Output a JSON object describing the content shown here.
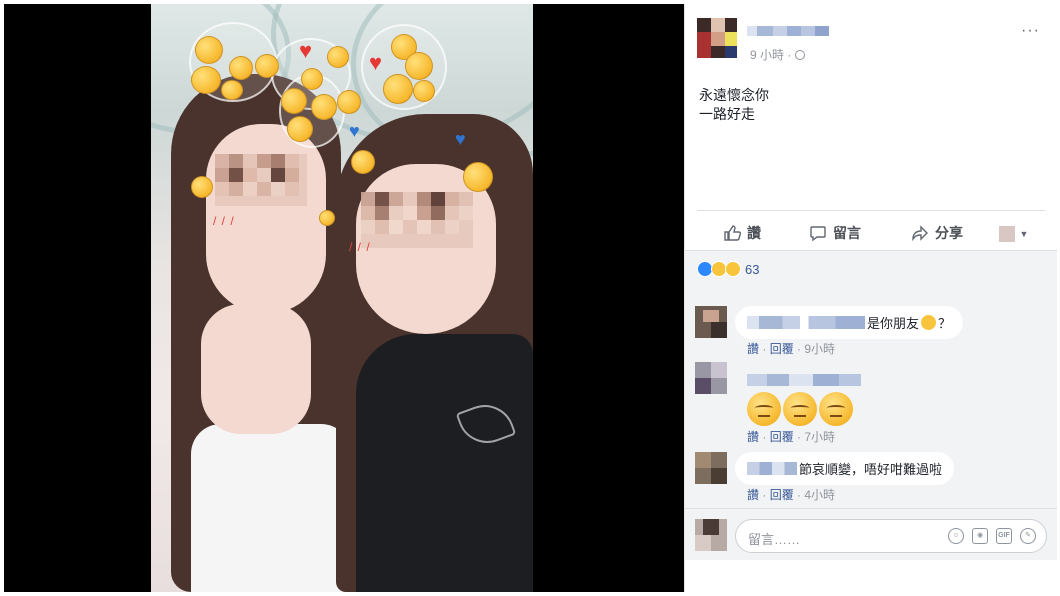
{
  "post": {
    "author_name": "",
    "timestamp": "9 小時",
    "privacy_icon": "globe-icon",
    "more_icon": "more-options-icon",
    "text_lines": [
      "永遠懷念你",
      "一路好走"
    ]
  },
  "actions": {
    "like": "讚",
    "comment": "留言",
    "share": "分享"
  },
  "reactions": {
    "icons": [
      "like-reaction-icon",
      "sad-reaction-icon",
      "wow-reaction-icon"
    ],
    "count": "63"
  },
  "comments": [
    {
      "author": "",
      "text": "是你朋友",
      "emoji": "sad-face-emoji",
      "suffix": "？",
      "like": "讚",
      "reply": "回覆",
      "time": "9小時"
    },
    {
      "author": "",
      "text": "",
      "emoji_count": 3,
      "emoji": "pensive-face-emoji",
      "like": "讚",
      "reply": "回覆",
      "time": "7小時"
    },
    {
      "author": "",
      "text": "節哀順變，唔好咁難過啦",
      "like": "讚",
      "reply": "回覆",
      "time": "4小時"
    }
  ],
  "composer": {
    "placeholder": "留言……",
    "icons": [
      "emoji-icon",
      "camera-icon",
      "gif-icon",
      "sticker-icon"
    ]
  },
  "colors": {
    "link": "#385898",
    "panel_bg": "#f2f3f5",
    "text": "#1d2129",
    "meta": "#90949c"
  }
}
